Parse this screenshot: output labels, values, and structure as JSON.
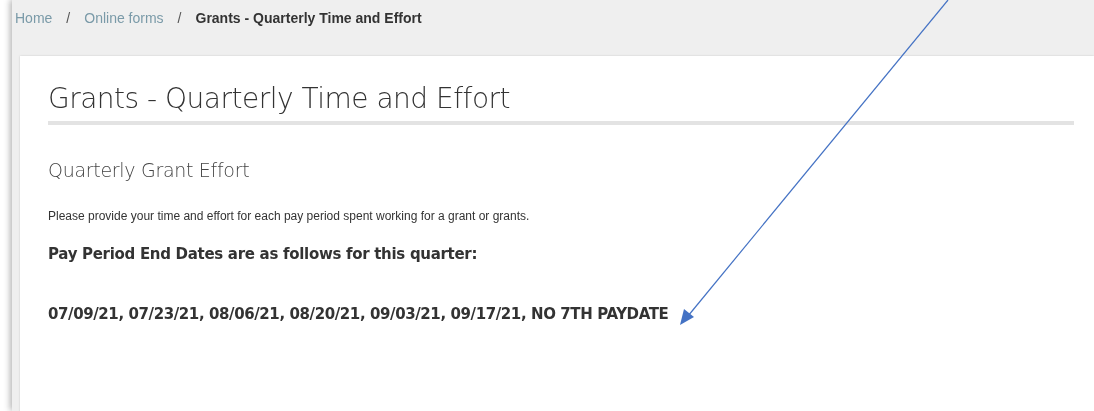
{
  "breadcrumb": {
    "items": [
      {
        "label": "Home",
        "kind": "link"
      },
      {
        "label": "Online forms",
        "kind": "link"
      },
      {
        "label": "Grants - Quarterly Time and Effort",
        "kind": "current"
      }
    ],
    "separator": "/"
  },
  "card": {
    "title": "Grants - Quarterly Time and Effort",
    "section_title": "Quarterly Grant Effort",
    "intro": "Please provide your time and effort for each pay period spent working for a grant or grants.",
    "dates_heading": "Pay Period End Dates are as follows for this quarter:",
    "dates": "07/09/21, 07/23/21, 08/06/21, 08/20/21, 09/03/21, 09/17/21, NO 7TH PAYDATE"
  }
}
